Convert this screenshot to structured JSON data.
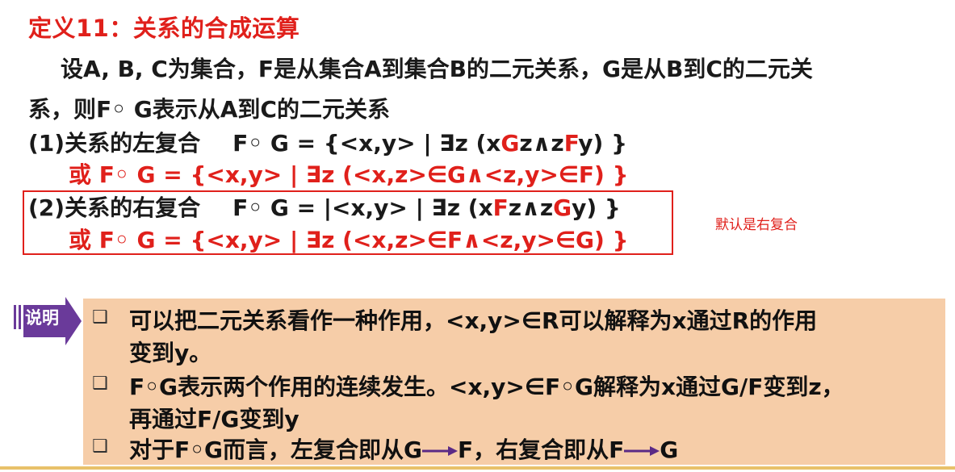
{
  "title": "定义11：关系的合成运算",
  "intro": {
    "line1": "设A, B, C为集合，F是从集合A到集合B的二元关系，G是从B到C的二元关",
    "line2": "系，则F◦ G表示从A到C的二元关系"
  },
  "left": {
    "label": "(1)关系的左复合",
    "expr_pre": "F◦ G = {<x,y> | ∃z (x",
    "expr_G": "G",
    "expr_mid": "z∧z",
    "expr_F": "F",
    "expr_post": "y) }",
    "alt": "或  F◦ G = {<x,y> | ∃z (<x,z>∈G∧<z,y>∈F) }"
  },
  "right": {
    "label": "(2)关系的右复合",
    "expr_pre": "F◦ G = |<x,y> | ∃z (x",
    "expr_F": "F",
    "expr_mid": "z∧z",
    "expr_G": "G",
    "expr_post": "y) }",
    "alt": "或  F◦ G = {<x,y> | ∃z (<x,z>∈F∧<z,y>∈G) }"
  },
  "annotation": "默认是右复合",
  "explain": {
    "tag": "说明",
    "bullet_glyph": "❑",
    "b1_line1": "可以把二元关系看作一种作用，<x,y>∈R可以解释为x通过R的作用",
    "b1_line2": "变到y。",
    "b2_line1": "F◦G表示两个作用的连续发生。<x,y>∈F◦G解释为x通过G/F变到z，",
    "b2_line2": "再通过F/G变到y",
    "b3_pre": "对于F◦G而言，左复合即从G",
    "b3_mid1": "F，右复合即从F",
    "b3_end": "G"
  },
  "colors": {
    "accent_red": "#e0201b",
    "panel": "#f6cda8",
    "tag_purple": "#6a3a9a",
    "arrow_purple": "#5b2a86"
  }
}
